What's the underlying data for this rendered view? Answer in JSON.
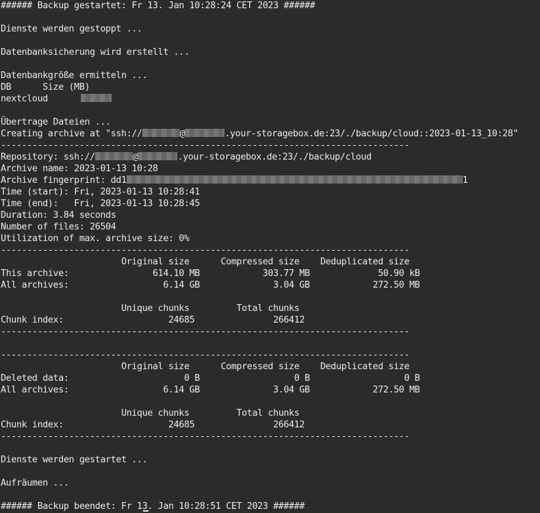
{
  "lines": [
    "###### Backup gestartet: Fr 13. Jan 10:28:24 CET 2023 ######",
    "Dienste werden gestoppt ...",
    "Datenbanksicherung wird erstellt ...",
    "Datenbankgröße ermitteln ...",
    "DB      Size (MB)",
    "nextcloud",
    "Übertrage Dateien ...",
    "Creating archive at \"ssh://",
    "@",
    ".your-storagebox.de:23/./backup/cloud::2023-01-13_10:28\"",
    "------------------------------------------------------------------------------",
    "Repository: ssh://",
    "@",
    ".your-storagebox.de:23/./backup/cloud",
    "Archive name: 2023-01-13 10:28",
    "Archive fingerprint: dd1",
    "1",
    "Time (start): Fri, 2023-01-13 10:28:41",
    "Time (end):   Fri, 2023-01-13 10:28:45",
    "Duration: 3.84 seconds",
    "Number of files: 26504",
    "Utilization of max. archive size: 0%",
    "------------------------------------------------------------------------------",
    "                       Original size      Compressed size    Deduplicated size",
    "This archive:                614.10 MB            303.77 MB             50.90 kB",
    "All archives:                  6.14 GB              3.04 GB            272.50 MB",
    "                       Unique chunks         Total chunks",
    "Chunk index:                    24685               266412",
    "------------------------------------------------------------------------------",
    "------------------------------------------------------------------------------",
    "                       Original size      Compressed size    Deduplicated size",
    "Deleted data:                      0 B                  0 B                  0 B",
    "All archives:                  6.14 GB              3.04 GB            272.50 MB",
    "                       Unique chunks         Total chunks",
    "Chunk index:                    24685               266412",
    "------------------------------------------------------------------------------",
    "Dienste werden gestartet ...",
    "Aufräumen ...",
    "###### Backup beendet: Fr 13. Jan 10:28:51 CET 2023 ######"
  ],
  "colors": {
    "background": "#2b2b2b",
    "text": "#ebebeb",
    "redacted": "#6c6c6c"
  }
}
